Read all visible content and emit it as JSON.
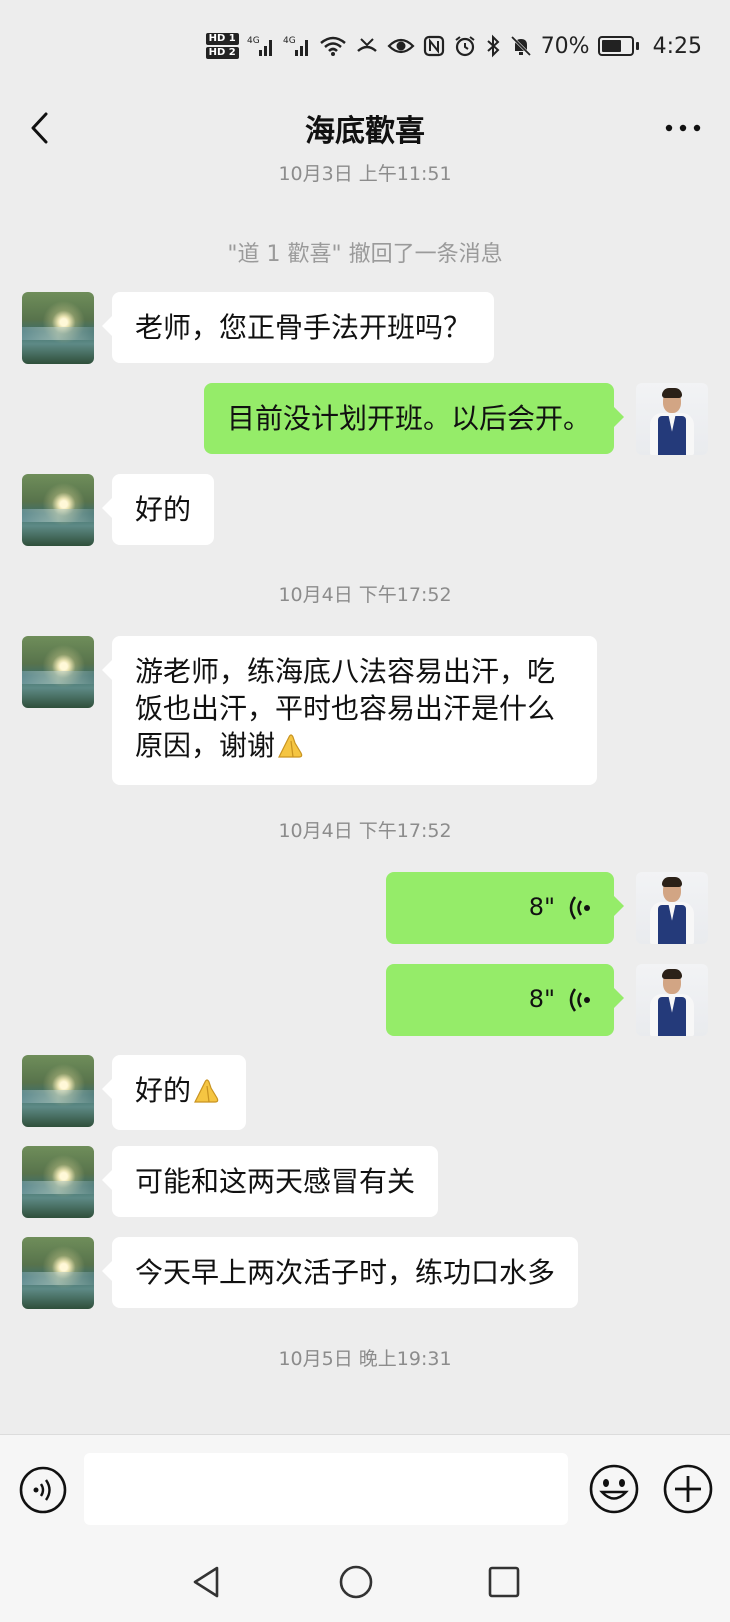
{
  "status_bar": {
    "hd1": "HD 1",
    "hd2": "HD 2",
    "battery": "70%",
    "time": "4:25",
    "icons": [
      "signal-icon",
      "signal-icon",
      "wifi-icon",
      "missed-call-icon",
      "eye-icon",
      "nfc-icon",
      "alarm-icon",
      "bluetooth-icon",
      "mute-icon",
      "battery-icon"
    ]
  },
  "header": {
    "title": "海底歡喜",
    "back_icon": "chevron-left-icon",
    "more_icon": "more-icon"
  },
  "messages": [
    {
      "type": "time",
      "text": "10月3日 上午11:51"
    },
    {
      "type": "system",
      "text": "\"道 1 歡喜\" 撤回了一条消息"
    },
    {
      "type": "text",
      "side": "left",
      "text": "老师，您正骨手法开班吗？"
    },
    {
      "type": "text",
      "side": "right",
      "text": "目前没计划开班。以后会开。"
    },
    {
      "type": "text",
      "side": "left",
      "text": "好的"
    },
    {
      "type": "time",
      "text": "10月4日 下午17:52"
    },
    {
      "type": "text",
      "side": "left",
      "line1": "游老师，练海底八法容易出汗，吃",
      "line2": "饭也出汗，平时也容易出汗是什么",
      "line3": "原因，谢谢"
    },
    {
      "type": "time",
      "text": "10月4日 下午17:52"
    },
    {
      "type": "voice",
      "side": "right",
      "duration": "8\""
    },
    {
      "type": "voice",
      "side": "right",
      "duration": "8\""
    },
    {
      "type": "text",
      "side": "left",
      "text": "好的"
    },
    {
      "type": "text",
      "side": "left",
      "text": "可能和这两天感冒有关"
    },
    {
      "type": "text",
      "side": "left",
      "text": "今天早上两次活子时，练功口水多"
    },
    {
      "type": "time",
      "text": "10月5日 晚上19:31"
    }
  ],
  "input_bar": {
    "voice_icon": "voice-input-icon",
    "emoji_icon": "emoji-icon",
    "plus_icon": "plus-icon",
    "input_value": ""
  },
  "nav_bar": {
    "icons": [
      "back-triangle-icon",
      "home-circle-icon",
      "recents-square-icon"
    ]
  },
  "colors": {
    "background": "#ededed",
    "bubble_sent": "#95ec69",
    "bubble_received": "#ffffff",
    "time_text": "#8c8c8c"
  }
}
